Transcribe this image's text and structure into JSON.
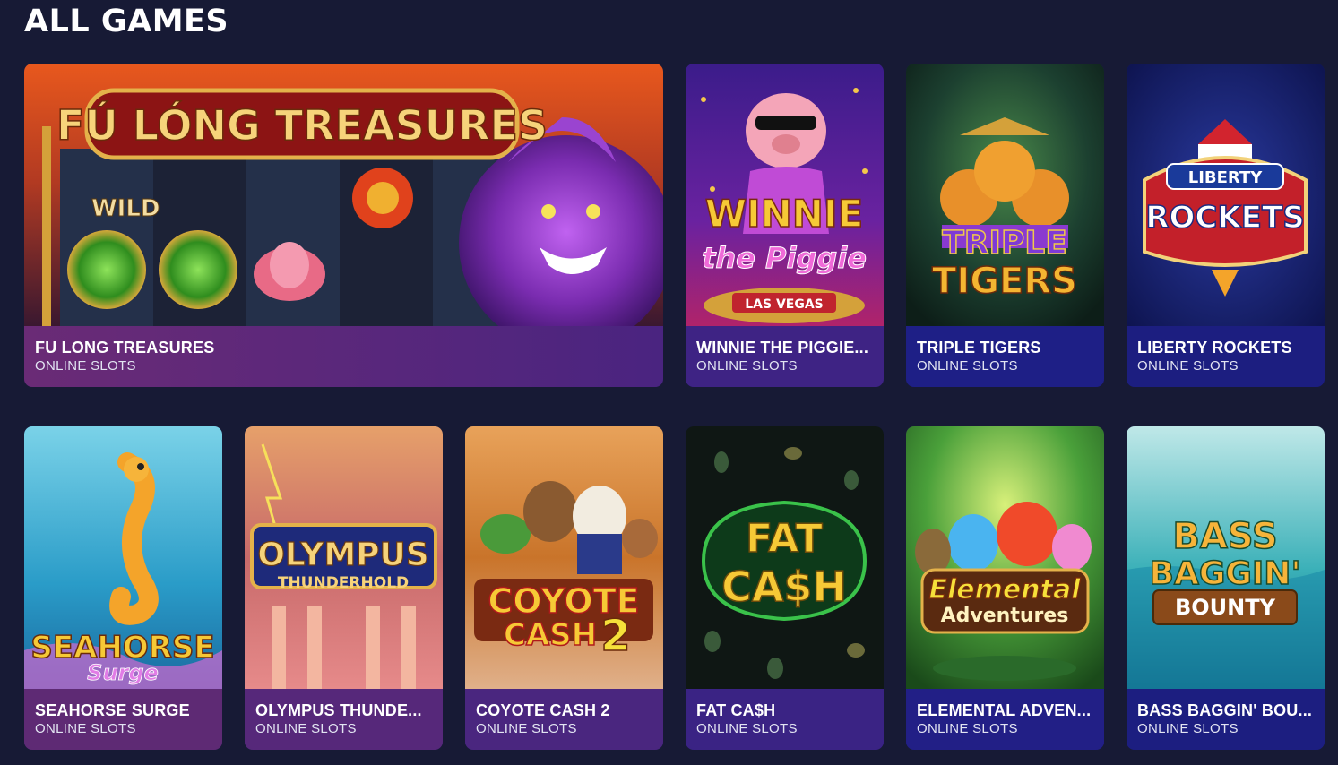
{
  "page": {
    "title": "ALL GAMES"
  },
  "games": [
    {
      "title": "FU LONG TREASURES",
      "category": "ONLINE SLOTS",
      "logo": "FÚ LÓNG TREASURES",
      "wild": "WILD",
      "info_color": "#5a2a78"
    },
    {
      "title": "WINNIE THE PIGGIE...",
      "category": "ONLINE SLOTS",
      "logo_line1": "WINNIE",
      "logo_line2": "the Piggie",
      "logo_line3": "LAS VEGAS",
      "info_color": "#3e2384"
    },
    {
      "title": "TRIPLE TIGERS",
      "category": "ONLINE SLOTS",
      "logo_line1": "TRIPLE",
      "logo_line2": "TIGERS",
      "info_color": "#1e1f86"
    },
    {
      "title": "LIBERTY ROCKETS",
      "category": "ONLINE SLOTS",
      "logo_line1": "LIBERTY",
      "logo_line2": "ROCKETS",
      "info_color": "#1c1e80"
    },
    {
      "title": "SEAHORSE SURGE",
      "category": "ONLINE SLOTS",
      "logo_line1": "SEAHORSE",
      "logo_line2": "Surge",
      "info_color": "#5e2a74"
    },
    {
      "title": "OLYMPUS THUNDE...",
      "category": "ONLINE SLOTS",
      "logo_line1": "OLYMPUS",
      "logo_line2": "THUNDERHOLD",
      "info_color": "#56287a"
    },
    {
      "title": "COYOTE CASH 2",
      "category": "ONLINE SLOTS",
      "logo_line1": "COYOTE",
      "logo_line2": "CASH",
      "logo_line3": "2",
      "info_color": "#4a267f"
    },
    {
      "title": "FAT CA$H",
      "category": "ONLINE SLOTS",
      "logo_line1": "FAT",
      "logo_line2": "CA$H",
      "info_color": "#3a2384"
    },
    {
      "title": "ELEMENTAL ADVEN...",
      "category": "ONLINE SLOTS",
      "logo_line1": "Elemental",
      "logo_line2": "Adventures",
      "info_color": "#221f86"
    },
    {
      "title": "BASS BAGGIN' BOU...",
      "category": "ONLINE SLOTS",
      "logo_line1": "BASS",
      "logo_line2": "BAGGIN'",
      "logo_line3": "BOUNTY",
      "info_color": "#1c1e80"
    }
  ]
}
